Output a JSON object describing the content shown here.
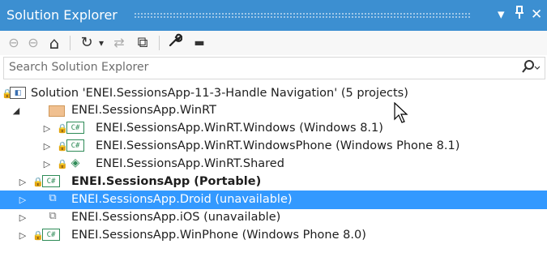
{
  "window": {
    "title": "Solution Explorer",
    "controls": {
      "dropdown": "▾",
      "pin": "ᵖ",
      "close": "✕"
    }
  },
  "toolbar": {
    "buttons": [
      {
        "name": "back-icon",
        "glyph": "⊖"
      },
      {
        "name": "forward-icon",
        "glyph": "⊖"
      },
      {
        "name": "home-icon",
        "glyph": "⌂"
      },
      {
        "name": "sync-history-icon",
        "glyph": "↻"
      },
      {
        "name": "dropdown-icon",
        "glyph": "▾"
      },
      {
        "name": "sync-icon",
        "glyph": "⇄"
      },
      {
        "name": "collapse-all-icon",
        "glyph": "⧉"
      },
      {
        "name": "properties-wrench-icon",
        "glyph": "🔧"
      },
      {
        "name": "pending-changes-icon",
        "glyph": "▬"
      }
    ]
  },
  "search": {
    "placeholder": "Search Solution Explorer",
    "icon": "⚲"
  },
  "tree": {
    "solution_label": "Solution 'ENEI.SessionsApp-11-3-Handle Navigation' (5 projects)",
    "items": [
      {
        "label": "ENEI.SessionsApp.WinRT",
        "expanded": true
      },
      {
        "label": "ENEI.SessionsApp.WinRT.Windows (Windows 8.1)"
      },
      {
        "label": "ENEI.SessionsApp.WinRT.WindowsPhone (Windows Phone 8.1)"
      },
      {
        "label": "ENEI.SessionsApp.WinRT.Shared"
      },
      {
        "label": "ENEI.SessionsApp (Portable)",
        "bold": true
      },
      {
        "label": "ENEI.SessionsApp.Droid (unavailable)",
        "selected": true
      },
      {
        "label": "ENEI.SessionsApp.iOS (unavailable)"
      },
      {
        "label": "ENEI.SessionsApp.WinPhone (Windows Phone 8.0)"
      }
    ],
    "cs_badge": "C#"
  },
  "colors": {
    "titlebar": "#3c8fd1",
    "selection": "#3399ff",
    "csharp": "#2e8b57"
  }
}
